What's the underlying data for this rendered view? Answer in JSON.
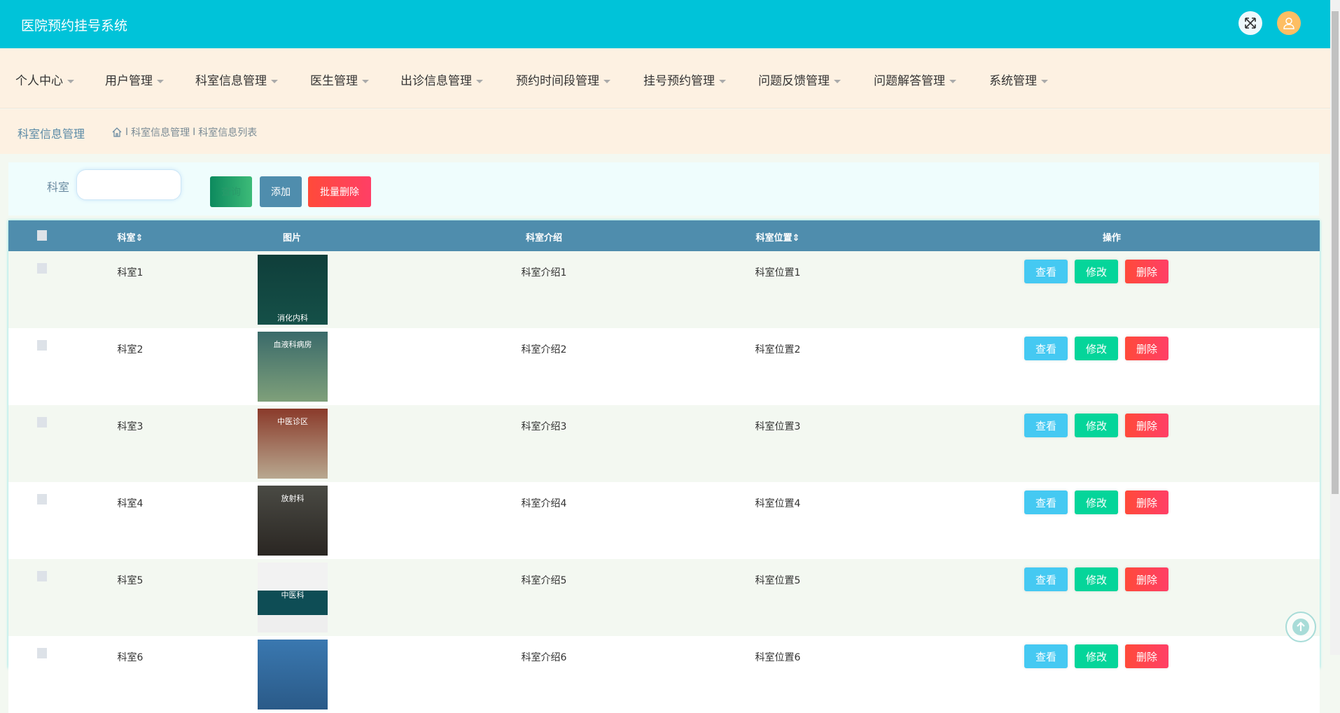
{
  "app": {
    "title": "医院预约挂号系统"
  },
  "nav": [
    {
      "label": "个人中心"
    },
    {
      "label": "用户管理"
    },
    {
      "label": "科室信息管理"
    },
    {
      "label": "医生管理"
    },
    {
      "label": "出诊信息管理"
    },
    {
      "label": "预约时间段管理"
    },
    {
      "label": "挂号预约管理"
    },
    {
      "label": "问题反馈管理"
    },
    {
      "label": "问题解答管理"
    },
    {
      "label": "系统管理"
    }
  ],
  "breadcrumb": {
    "title": "科室信息管理",
    "sep": "I",
    "items": [
      "科室信息管理",
      "科室信息列表"
    ]
  },
  "search": {
    "label": "科室",
    "value": "",
    "placeholder": "",
    "query": "查询",
    "add": "添加",
    "batch_delete": "批量删除"
  },
  "table": {
    "headers": {
      "name": "科室",
      "image": "图片",
      "intro": "科室介绍",
      "location": "科室位置",
      "actions": "操作",
      "sort": "⇕"
    },
    "rows": [
      {
        "name": "科室1",
        "intro": "科室介绍1",
        "location": "科室位置1",
        "image_text": "消化内科"
      },
      {
        "name": "科室2",
        "intro": "科室介绍2",
        "location": "科室位置2",
        "image_text": "血液科病房"
      },
      {
        "name": "科室3",
        "intro": "科室介绍3",
        "location": "科室位置3",
        "image_text": "中医诊区"
      },
      {
        "name": "科室4",
        "intro": "科室介绍4",
        "location": "科室位置4",
        "image_text": "放射科"
      },
      {
        "name": "科室5",
        "intro": "科室介绍5",
        "location": "科室位置5",
        "image_text": "中医科"
      },
      {
        "name": "科室6",
        "intro": "科室介绍6",
        "location": "科室位置6",
        "image_text": ""
      }
    ],
    "actions": {
      "view": "查看",
      "edit": "修改",
      "delete": "删除"
    }
  },
  "colors": {
    "topbar": "#00c3d9",
    "nav_bg": "#fdf1e2",
    "table_header": "#4f8dad",
    "view": "#45c9f2",
    "edit": "#05d59a",
    "delete": "#ff4a4a"
  }
}
